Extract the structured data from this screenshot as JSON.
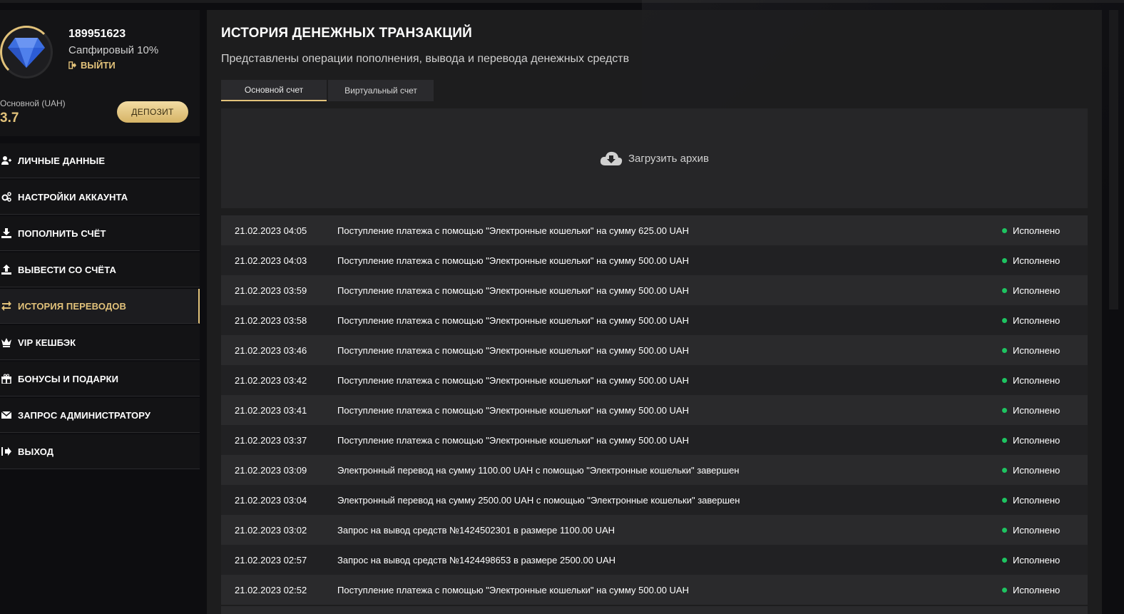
{
  "profile": {
    "user_id": "189951623",
    "level": "Сапфировый 10%",
    "logout_label": "ВЫЙТИ",
    "balance_label": "Основной (UAH)",
    "balance_value": "3.7",
    "deposit_label": "ДЕПОЗИТ",
    "accent_color": "#e2c27a"
  },
  "menu": {
    "items": [
      {
        "label": "ЛИЧНЫЕ ДАННЫЕ",
        "icon": "user-add-icon"
      },
      {
        "label": "НАСТРОЙКИ АККАУНТА",
        "icon": "gears-icon"
      },
      {
        "label": "ПОПОЛНИТЬ СЧЁТ",
        "icon": "download-icon"
      },
      {
        "label": "ВЫВЕСТИ СО СЧЁТА",
        "icon": "upload-icon"
      },
      {
        "label": "ИСТОРИЯ ПЕРЕВОДОВ",
        "icon": "transfer-icon",
        "active": true
      },
      {
        "label": "VIP КЕШБЭК",
        "icon": "crown-icon"
      },
      {
        "label": "БОНУСЫ И ПОДАРКИ",
        "icon": "gift-icon"
      },
      {
        "label": "ЗАПРОС АДМИНИСТРАТОРУ",
        "icon": "envelope-icon"
      },
      {
        "label": "ВЫХОД",
        "icon": "logout-icon"
      }
    ]
  },
  "main": {
    "title": "ИСТОРИЯ ДЕНЕЖНЫХ ТРАНЗАКЦИЙ",
    "subtitle": "Представлены операции пополнения, вывода и перевода денежных средств",
    "tabs": [
      {
        "label": "Основной счет",
        "active": true
      },
      {
        "label": "Виртуальный счет",
        "active": false
      }
    ],
    "archive_label": "Загрузить архив",
    "status_color": "#1ec461"
  },
  "transactions": [
    {
      "date": "21.02.2023 04:05",
      "desc": "Поступление платежа с помощью \"Электронные кошельки\" на сумму 625.00 UAH",
      "status": "Исполнено"
    },
    {
      "date": "21.02.2023 04:03",
      "desc": "Поступление платежа с помощью \"Электронные кошельки\" на сумму 500.00 UAH",
      "status": "Исполнено"
    },
    {
      "date": "21.02.2023 03:59",
      "desc": "Поступление платежа с помощью \"Электронные кошельки\" на сумму 500.00 UAH",
      "status": "Исполнено"
    },
    {
      "date": "21.02.2023 03:58",
      "desc": "Поступление платежа с помощью \"Электронные кошельки\" на сумму 500.00 UAH",
      "status": "Исполнено"
    },
    {
      "date": "21.02.2023 03:46",
      "desc": "Поступление платежа с помощью \"Электронные кошельки\" на сумму 500.00 UAH",
      "status": "Исполнено"
    },
    {
      "date": "21.02.2023 03:42",
      "desc": "Поступление платежа с помощью \"Электронные кошельки\" на сумму 500.00 UAH",
      "status": "Исполнено"
    },
    {
      "date": "21.02.2023 03:41",
      "desc": "Поступление платежа с помощью \"Электронные кошельки\" на сумму 500.00 UAH",
      "status": "Исполнено"
    },
    {
      "date": "21.02.2023 03:37",
      "desc": "Поступление платежа с помощью \"Электронные кошельки\" на сумму 500.00 UAH",
      "status": "Исполнено"
    },
    {
      "date": "21.02.2023 03:09",
      "desc": "Электронный перевод на сумму 1100.00 UAH с помощью \"Электронные кошельки\" завершен",
      "status": "Исполнено"
    },
    {
      "date": "21.02.2023 03:04",
      "desc": "Электронный перевод на сумму 2500.00 UAH с помощью \"Электронные кошельки\" завершен",
      "status": "Исполнено"
    },
    {
      "date": "21.02.2023 03:02",
      "desc": "Запрос на вывод средств №1424502301 в размере 1100.00 UAH",
      "status": "Исполнено"
    },
    {
      "date": "21.02.2023 02:57",
      "desc": "Запрос на вывод средств №1424498653 в размере 2500.00 UAH",
      "status": "Исполнено"
    },
    {
      "date": "21.02.2023 02:52",
      "desc": "Поступление платежа с помощью \"Электронные кошельки\" на сумму 500.00 UAH",
      "status": "Исполнено"
    }
  ]
}
